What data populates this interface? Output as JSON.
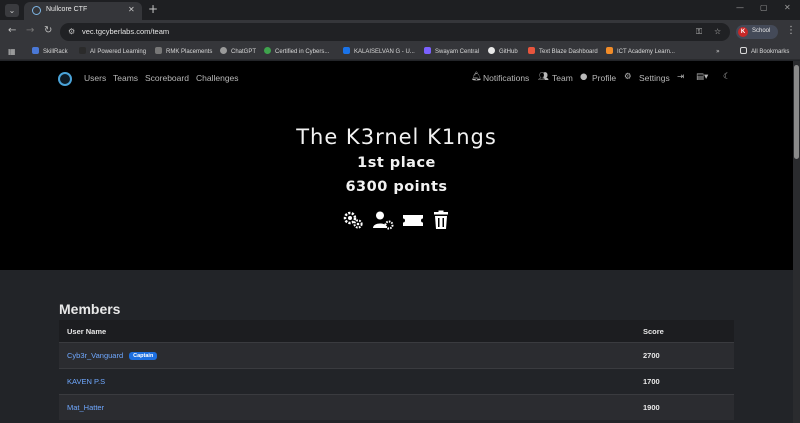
{
  "browser": {
    "tab_title": "Nullcore CTF",
    "url": "vec.tgcyberlabs.com/team",
    "profile_label": "School",
    "profile_initial": "K",
    "bookmarks": [
      {
        "label": "SkillRack",
        "color": "#4a78d6"
      },
      {
        "label": "AI Powered Learning",
        "color": "#2b2b2b"
      },
      {
        "label": "RMK Placements",
        "color": "#777777"
      },
      {
        "label": "ChatGPT",
        "color": "#9a9a9a"
      },
      {
        "label": "Certified in Cybers...",
        "color": "#3fa34d"
      },
      {
        "label": "KALAISELVAN G - U...",
        "color": "#1a73e8"
      },
      {
        "label": "Swayam Central",
        "color": "#7b61ff"
      },
      {
        "label": "GitHub",
        "color": "#e8e8e8"
      },
      {
        "label": "Text Blaze Dashboard",
        "color": "#e8553d"
      },
      {
        "label": "ICT Academy Learn...",
        "color": "#f28c28"
      }
    ],
    "all_bookmarks_label": "All Bookmarks"
  },
  "nav": {
    "links": [
      "Users",
      "Teams",
      "Scoreboard",
      "Challenges"
    ],
    "notifications": "Notifications",
    "team": "Team",
    "profile": "Profile",
    "settings": "Settings"
  },
  "team": {
    "name": "The K3rnel K1ngs",
    "place": "1st place",
    "points": "6300 points"
  },
  "members": {
    "title": "Members",
    "col_user": "User Name",
    "col_score": "Score",
    "rows": [
      {
        "name": "Cyb3r_Vanguard",
        "badge": "Captain",
        "score": "2700"
      },
      {
        "name": "KAVEN P.S",
        "badge": "",
        "score": "1700"
      },
      {
        "name": "Mat_Hatter",
        "badge": "",
        "score": "1900"
      }
    ]
  }
}
